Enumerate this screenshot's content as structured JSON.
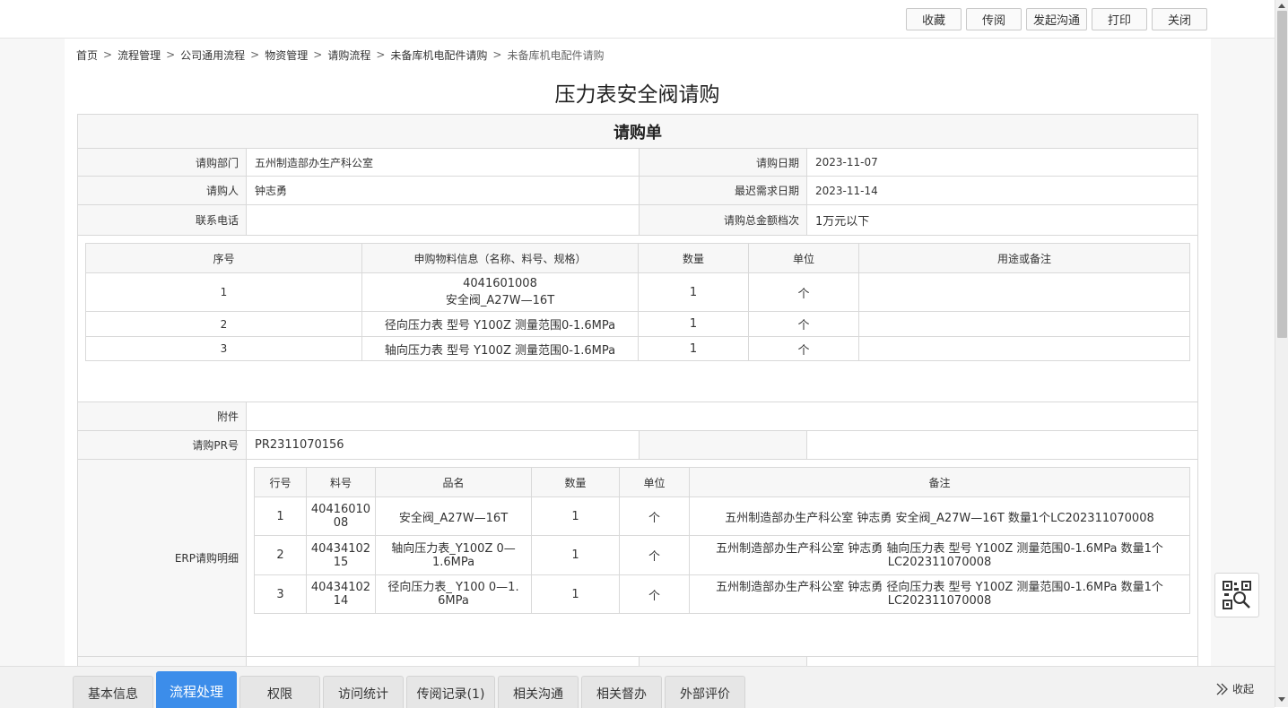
{
  "toolbar": {
    "favorite": "收藏",
    "circulate": "传阅",
    "start_communication": "发起沟通",
    "print": "打印",
    "close": "关闭"
  },
  "breadcrumb": [
    "首页",
    "流程管理",
    "公司通用流程",
    "物资管理",
    "请购流程",
    "未备库机电配件请购",
    "未备库机电配件请购"
  ],
  "page_title": "压力表安全阀请购",
  "form": {
    "section_title": "请购单",
    "dept_label": "请购部门",
    "dept_value": "五州制造部办生产科公室",
    "date_label": "请购日期",
    "date_value": "2023-11-07",
    "requester_label": "请购人",
    "requester_value": "钟志勇",
    "latest_date_label": "最迟需求日期",
    "latest_date_value": "2023-11-14",
    "phone_label": "联系电话",
    "phone_value": "",
    "amount_label": "请购总金额档次",
    "amount_value": "1万元以下",
    "attachment_label": "附件",
    "pr_label": "请购PR号",
    "pr_value": "PR2311070156",
    "erp_label": "ERP请购明细"
  },
  "items_table": {
    "headers": [
      "序号",
      "申购物料信息（名称、料号、规格）",
      "数量",
      "单位",
      "用途或备注"
    ],
    "rows": [
      {
        "no": "1",
        "info_line1": "4041601008",
        "info_line2": "安全阀_A27W—16T",
        "qty": "1",
        "unit": "个",
        "note": ""
      },
      {
        "no": "2",
        "info_line1": "径向压力表 型号 Y100Z  测量范围0-1.6MPa",
        "info_line2": "",
        "qty": "1",
        "unit": "个",
        "note": ""
      },
      {
        "no": "3",
        "info_line1": "轴向压力表 型号 Y100Z  测量范围0-1.6MPa",
        "info_line2": "",
        "qty": "1",
        "unit": "个",
        "note": ""
      }
    ]
  },
  "erp_table": {
    "headers": [
      "行号",
      "料号",
      "品名",
      "数量",
      "单位",
      "备注"
    ],
    "rows": [
      {
        "line": "1",
        "code1": "40416010",
        "code2": "08",
        "name1": "安全阀_A27W—16T",
        "name2": "",
        "qty": "1",
        "unit": "个",
        "remark1": "五州制造部办生产科公室 钟志勇 安全阀_A27W—16T 数量1个LC202311070008",
        "remark2": ""
      },
      {
        "line": "2",
        "code1": "40434102",
        "code2": "15",
        "name1": "轴向压力表_Y100Z 0—",
        "name2": "1.6MPa",
        "qty": "1",
        "unit": "个",
        "remark1": "五州制造部办生产科公室 钟志勇 轴向压力表 型号 Y100Z  测量范围0-1.6MPa  数量1个",
        "remark2": "LC202311070008"
      },
      {
        "line": "3",
        "code1": "40434102",
        "code2": "14",
        "name1": "径向压力表_ Y100 0—1.",
        "name2": "6MPa",
        "qty": "1",
        "unit": "个",
        "remark1": "五州制造部办生产科公室 钟志勇  径向压力表 型号 Y100Z  测量范围0-1.6MPa 数量1个",
        "remark2": "LC202311070008"
      }
    ]
  },
  "tabs": [
    "基本信息",
    "流程处理",
    "权限",
    "访问统计",
    "传阅记录(1)",
    "相关沟通",
    "相关督办",
    "外部评价"
  ],
  "active_tab": "流程处理",
  "collapse_label": "收起",
  "colors": {
    "accent": "#3c8dea",
    "label_bg": "#f7f7f7",
    "border": "#d9d9d9"
  }
}
